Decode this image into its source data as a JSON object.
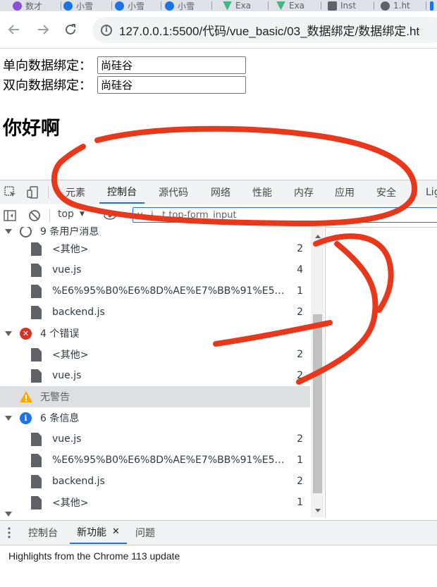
{
  "browser": {
    "tabs": [
      {
        "title": "数才",
        "favicon_color": "#8a4fd6"
      },
      {
        "title": "小雪",
        "favicon_color": "#1a73e8"
      },
      {
        "title": "小雪",
        "favicon_color": "#1a73e8"
      },
      {
        "title": "小雪",
        "favicon_color": "#1a73e8"
      },
      {
        "title": "Exa",
        "favicon_color": "#41b883"
      },
      {
        "title": "Exa",
        "favicon_color": "#41b883"
      },
      {
        "title": "Inst",
        "favicon_color": "#5f6368"
      },
      {
        "title": "1.ht",
        "favicon_color": "#5f6368"
      }
    ],
    "url": "127.0.0.1:5500/代码/vue_basic/03_数据绑定/数据绑定.ht"
  },
  "page": {
    "one_way_label": "单向数据绑定：",
    "one_way_value": "尚硅谷",
    "two_way_label": "双向数据绑定：",
    "two_way_value": "尚硅谷",
    "heading": "你好啊"
  },
  "devtools": {
    "tabs": [
      "元素",
      "控制台",
      "源代码",
      "网络",
      "性能",
      "内存",
      "应用",
      "安全",
      "Lig"
    ],
    "active_tab": "控制台",
    "context": "top",
    "filter_text": "v...i...t.top-form_input",
    "sidebar": [
      {
        "type": "group",
        "icon": "user",
        "label": "9 条用户消息",
        "count": ""
      },
      {
        "type": "file",
        "label": "<其他>",
        "count": "2"
      },
      {
        "type": "file",
        "label": "vue.js",
        "count": "4"
      },
      {
        "type": "file",
        "label": "%E6%95%B0%E6%8D%AE%E7%BB%91%E5%AE...",
        "count": "1"
      },
      {
        "type": "file",
        "label": "backend.js",
        "count": "2"
      },
      {
        "type": "group",
        "icon": "error",
        "label": "4 个错误",
        "count": ""
      },
      {
        "type": "file",
        "label": "<其他>",
        "count": "2"
      },
      {
        "type": "file",
        "label": "vue.js",
        "count": "2"
      },
      {
        "type": "warn",
        "icon": "warning",
        "label": "无警告",
        "count": ""
      },
      {
        "type": "group",
        "icon": "info",
        "label": "6 条信息",
        "count": ""
      },
      {
        "type": "file",
        "label": "vue.js",
        "count": "2"
      },
      {
        "type": "file",
        "label": "%E6%95%B0%E6%8D%AE%E7%BB%91%E5%AE...",
        "count": "1"
      },
      {
        "type": "file",
        "label": "backend.js",
        "count": "2"
      },
      {
        "type": "file",
        "label": "<其他>",
        "count": "1"
      }
    ],
    "drawer_tabs": [
      "控制台",
      "新功能",
      "问题"
    ],
    "drawer_active": "新功能",
    "drawer_message": "Highlights from the Chrome 113 update"
  },
  "colors": {
    "annotation": "#e8371b",
    "accent": "#1a73e8",
    "error": "#d93025",
    "warning": "#f9ab00",
    "info": "#1a73e8"
  }
}
